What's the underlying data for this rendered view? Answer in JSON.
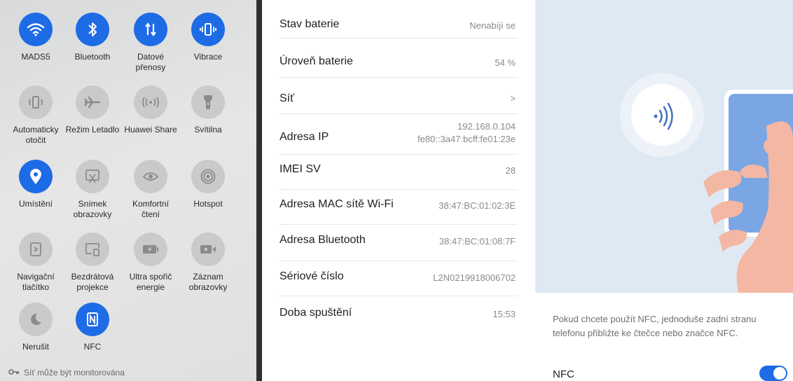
{
  "quick_settings": {
    "tiles": [
      {
        "label": "MADS5",
        "icon": "wifi-icon",
        "active": true
      },
      {
        "label": "Bluetooth",
        "icon": "bluetooth-icon",
        "active": true
      },
      {
        "label": "Datové\npřenosy",
        "icon": "mobile-data-icon",
        "active": true
      },
      {
        "label": "Vibrace",
        "icon": "vibrate-icon",
        "active": true
      },
      {
        "label": "Automaticky\notočit",
        "icon": "auto-rotate-icon",
        "active": false
      },
      {
        "label": "Režim Letadlo",
        "icon": "airplane-icon",
        "active": false
      },
      {
        "label": "Huawei Share",
        "icon": "huawei-share-icon",
        "active": false
      },
      {
        "label": "Svítilna",
        "icon": "flashlight-icon",
        "active": false
      },
      {
        "label": "Umístění",
        "icon": "location-icon",
        "active": true
      },
      {
        "label": "Snímek\nobrazovky",
        "icon": "screenshot-icon",
        "active": false
      },
      {
        "label": "Komfortní\nčtení",
        "icon": "eye-comfort-icon",
        "active": false
      },
      {
        "label": "Hotspot",
        "icon": "hotspot-icon",
        "active": false
      },
      {
        "label": "Navigační\ntlačítko",
        "icon": "navigation-button-icon",
        "active": false
      },
      {
        "label": "Bezdrátová\nprojekce",
        "icon": "wireless-projection-icon",
        "active": false
      },
      {
        "label": "Ultra spořič\nenergie",
        "icon": "power-saver-icon",
        "active": false
      },
      {
        "label": "Záznam\nobrazovky",
        "icon": "screen-record-icon",
        "active": false
      },
      {
        "label": "Nerušit",
        "icon": "do-not-disturb-icon",
        "active": false
      },
      {
        "label": "NFC",
        "icon": "nfc-icon",
        "active": true
      }
    ],
    "footer_text": "Síť může být monitorována",
    "accent_color": "#1e6be6"
  },
  "device_info": {
    "rows": [
      {
        "key": "Stav baterie",
        "value": "Nenabíjí se"
      },
      {
        "key": "Úroveň baterie",
        "value": "54 %"
      },
      {
        "key": "Síť",
        "value": ">"
      },
      {
        "key": "Adresa IP",
        "value": "192.168.0.104\nfe80::3a47:bcff:fe01:23e"
      },
      {
        "key": "IMEI SV",
        "value": "28"
      },
      {
        "key": "Adresa MAC sítě Wi-Fi",
        "value": "38:47:BC:01:02:3E"
      },
      {
        "key": "Adresa Bluetooth",
        "value": "38:47:BC:01:08:7F"
      },
      {
        "key": "Sériové číslo",
        "value": "L2N0219918006702"
      },
      {
        "key": "Doba spuštění",
        "value": "15:53"
      }
    ]
  },
  "nfc_panel": {
    "description": "Pokud chcete použít NFC, jednoduše zadní stranu telefonu přibližte ke čtečce nebo značce NFC.",
    "toggle_label": "NFC",
    "toggle_on": true
  }
}
